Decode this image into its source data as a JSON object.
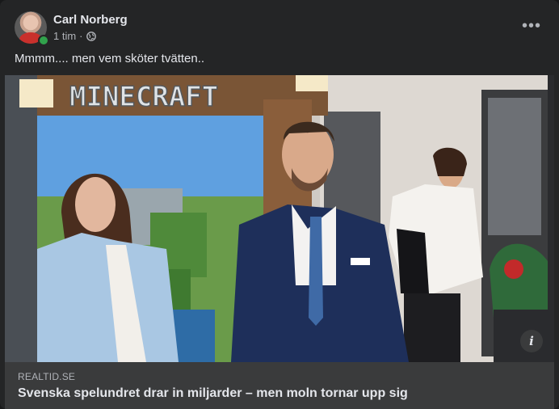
{
  "post": {
    "author": "Carl Norberg",
    "time": "1 tim",
    "separator": "·",
    "privacy_icon": "globe-icon",
    "more_icon": "more-horizontal-icon",
    "more_label": "•••",
    "text": "Mmmm.... men vem sköter tvätten.."
  },
  "image": {
    "sign_text": "MINECRAFT",
    "info_label": "i"
  },
  "link": {
    "domain": "realtid.se",
    "title": "Svenska spelundret drar in miljarder – men moln tornar upp sig"
  },
  "colors": {
    "background": "#242526",
    "link_box": "#3a3b3c",
    "online": "#31a24c"
  }
}
